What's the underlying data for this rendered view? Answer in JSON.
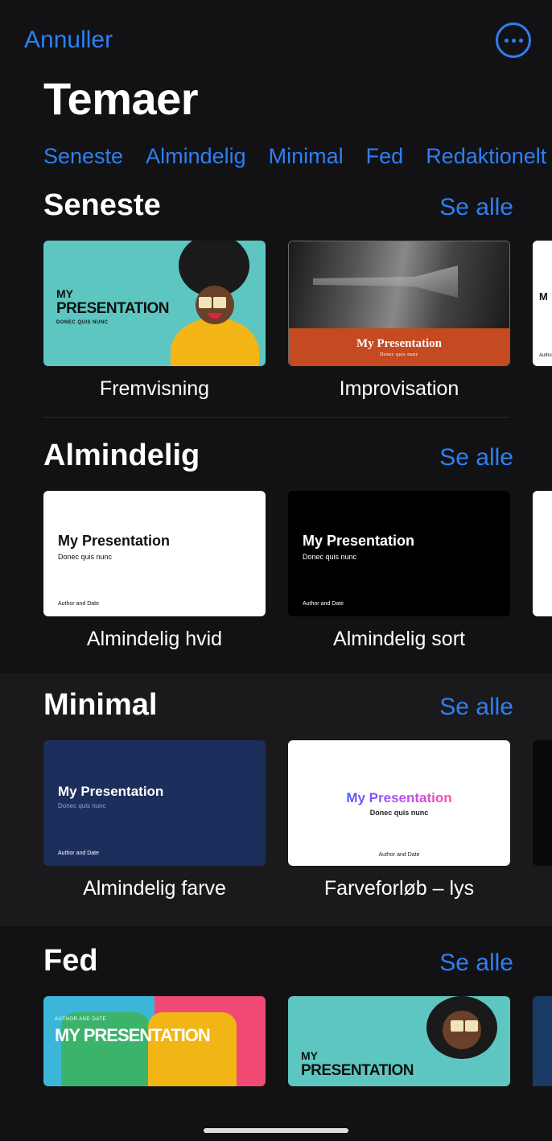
{
  "header": {
    "cancel": "Annuller"
  },
  "title": "Temaer",
  "tabs": [
    "Seneste",
    "Almindelig",
    "Minimal",
    "Fed",
    "Redaktionelt"
  ],
  "see_all": "Se alle",
  "thumb_strings": {
    "my": "MY",
    "presentation_upper": "PRESENTATION",
    "my_presentation": "My Presentation",
    "my_presentation_upper": "MY PRESENTATION",
    "donec": "Donec quis nunc",
    "donec_upper": "DONEC QUIS NUNC",
    "author_date": "Author and Date",
    "author_date_upper": "AUTHOR AND DATE"
  },
  "sections": {
    "seneste": {
      "title": "Seneste",
      "items": [
        {
          "label": "Fremvisning"
        },
        {
          "label": "Improvisation"
        }
      ]
    },
    "almindelig": {
      "title": "Almindelig",
      "items": [
        {
          "label": "Almindelig hvid"
        },
        {
          "label": "Almindelig sort"
        }
      ]
    },
    "minimal": {
      "title": "Minimal",
      "items": [
        {
          "label": "Almindelig farve"
        },
        {
          "label": "Farveforløb – lys"
        }
      ]
    },
    "fed": {
      "title": "Fed"
    }
  }
}
